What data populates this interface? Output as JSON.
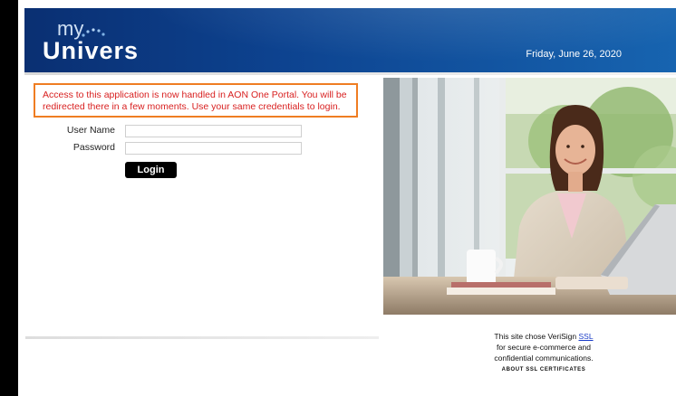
{
  "header": {
    "logo_my": "my",
    "logo_univers": "Univers",
    "date": "Friday, June 26, 2020"
  },
  "notice": {
    "text": "Access to this application is now handled in AON One Portal. You will be redirected there in a few moments. Use your same credentials to login."
  },
  "login": {
    "username_label": "User Name",
    "password_label": "Password",
    "username_value": "",
    "password_value": "",
    "button_label": "Login"
  },
  "ssl": {
    "line1_prefix": "This site chose VeriSign ",
    "link": "SSL",
    "line2": "for secure e-commerce and",
    "line3": "confidential communications.",
    "about": "ABOUT SSL CERTIFICATES"
  },
  "colors": {
    "header_blue": "#0d4390",
    "notice_border": "#ef7d22",
    "notice_text": "#d81f1f",
    "button": "#000000"
  }
}
